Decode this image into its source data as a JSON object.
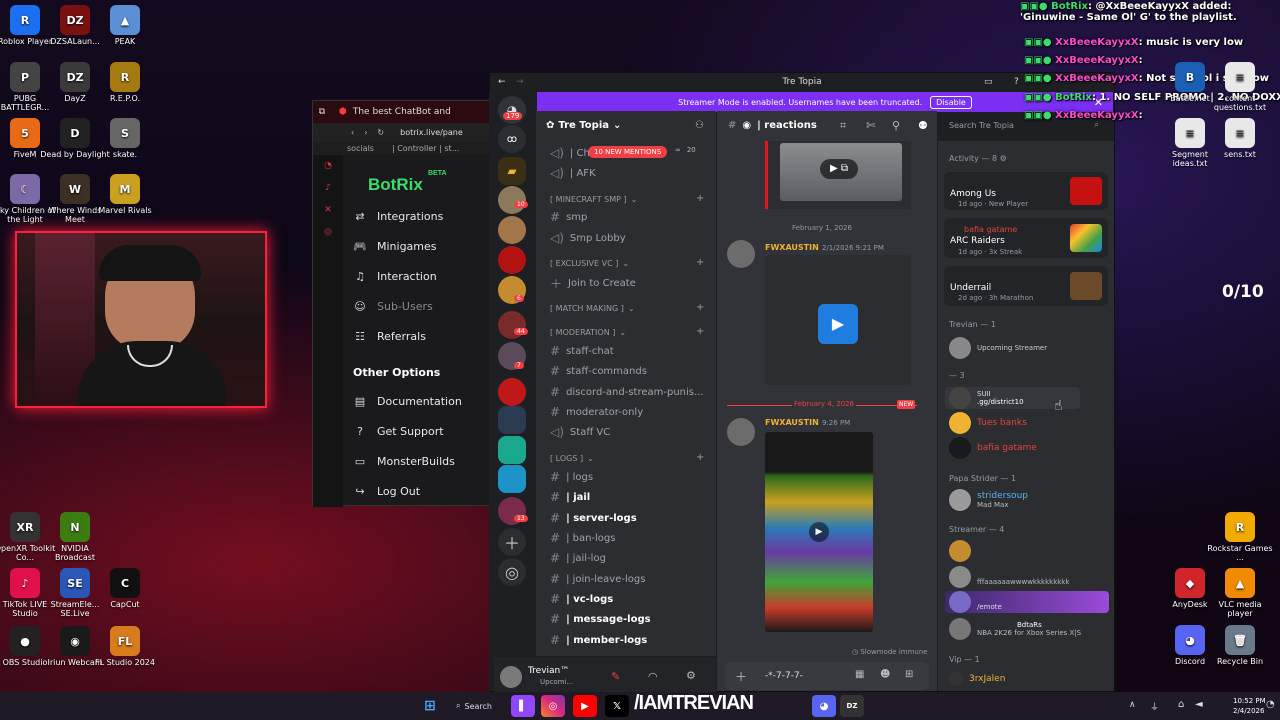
{
  "desktop_icons_left": [
    {
      "label": "Roblox Player",
      "glyph": "R",
      "color": "#1d6ff2"
    },
    {
      "label": "DZSALaun...",
      "glyph": "DZ",
      "color": "#7a1010"
    },
    {
      "label": "PEAK",
      "glyph": "▲",
      "color": "#5a8fd6"
    },
    {
      "label": "PUBG BATTLEGR...",
      "glyph": "P",
      "color": "#444"
    },
    {
      "label": "DayZ",
      "glyph": "DZ",
      "color": "#3a3a3a"
    },
    {
      "label": "R.E.P.O.",
      "glyph": "R",
      "color": "#a57a12"
    },
    {
      "label": "FiveM",
      "glyph": "5",
      "color": "#e86a17"
    },
    {
      "label": "Dead by Daylight",
      "glyph": "D",
      "color": "#222"
    },
    {
      "label": "skate.",
      "glyph": "S",
      "color": "#666"
    },
    {
      "label": "Sky Children of the Light",
      "glyph": "☾",
      "color": "#7c6aa6"
    },
    {
      "label": "Where Winds Meet",
      "glyph": "W",
      "color": "#3c2f24"
    },
    {
      "label": "Marvel Rivals",
      "glyph": "M",
      "color": "#c9a020"
    },
    {
      "label": "OpenXR Toolkit Co...",
      "glyph": "XR",
      "color": "#333"
    },
    {
      "label": "NVIDIA Broadcast",
      "glyph": "N",
      "color": "#3c7d12"
    },
    {
      "label": "TikTok LIVE Studio",
      "glyph": "♪",
      "color": "#e0114a"
    },
    {
      "label": "StreamEle... SE.Live",
      "glyph": "SE",
      "color": "#2a56b8"
    },
    {
      "label": "CapCut",
      "glyph": "C",
      "color": "#111"
    },
    {
      "label": "OBS Studio",
      "glyph": "●",
      "color": "#222"
    },
    {
      "label": "Iriun Webcam",
      "glyph": "◉",
      "color": "#1a1a1a"
    },
    {
      "label": "FL Studio 2024",
      "glyph": "FL",
      "color": "#d77b1c"
    }
  ],
  "desktop_icons_right": [
    {
      "label": "Battle.net",
      "glyph": "B",
      "color": "#1a5fb4"
    },
    {
      "label": "content questions.txt",
      "glyph": "≡",
      "color": "#e8e8e8"
    },
    {
      "label": "Segment ideas.txt",
      "glyph": "≡",
      "color": "#e8e8e8"
    },
    {
      "label": "sens.txt",
      "glyph": "≡",
      "color": "#e8e8e8"
    },
    {
      "label": "Rockstar Games ...",
      "glyph": "R",
      "color": "#f2a900"
    },
    {
      "label": "AnyDesk",
      "glyph": "◆",
      "color": "#d1252c"
    },
    {
      "label": "VLC media player",
      "glyph": "▲",
      "color": "#f28a00"
    },
    {
      "label": "Discord",
      "glyph": "◕",
      "color": "#5865f2"
    },
    {
      "label": "Recycle Bin",
      "glyph": "🗑",
      "color": "#6a7a8a"
    }
  ],
  "overlay": {
    "counter": "0/10",
    "chat": [
      {
        "user": "BotRix",
        "text": ": @XxBeeeKayyxX added: 'Ginuwine - Same Ol' G' to the playlist."
      },
      {
        "user": "XxBeeeKayyxX",
        "text": ": music is very low"
      },
      {
        "user": "XxBeeeKayyxX",
        "text": ":"
      },
      {
        "user": "XxBeeeKayyxX",
        "text": ": Not slow lol i said low"
      },
      {
        "user": "BotRix",
        "text": ": 1. NO SELF PROMO | 2. NO DOXXING"
      },
      {
        "user": "XxBeeeKayyxX",
        "text": ":"
      }
    ]
  },
  "botrix": {
    "tab_title": "The best ChatBot and",
    "url": "botrix.live/pane",
    "bookmarks": [
      "socials",
      "| Controller | st..."
    ],
    "logo": "BotRix",
    "beta": "BETA",
    "menu": [
      {
        "label": "Integrations",
        "icon": "⇄",
        "icon_name": "integrations-icon"
      },
      {
        "label": "Minigames",
        "icon": "🎮",
        "icon_name": "gamepad-icon"
      },
      {
        "label": "Interaction",
        "icon": "♫",
        "icon_name": "music-icon"
      },
      {
        "label": "Sub-Users",
        "icon": "☺",
        "icon_name": "users-icon"
      },
      {
        "label": "Referrals",
        "icon": "☷",
        "icon_name": "referrals-icon"
      }
    ],
    "other_heading": "Other Options",
    "other": [
      {
        "label": "Documentation",
        "icon": "▤",
        "icon_name": "document-icon"
      },
      {
        "label": "Get Support",
        "icon": "?",
        "icon_name": "support-icon"
      },
      {
        "label": "MonsterBuilds",
        "icon": "▭",
        "icon_name": "monitor-icon"
      },
      {
        "label": "Log Out",
        "icon": "↪",
        "icon_name": "logout-icon"
      }
    ]
  },
  "discord": {
    "title": "Tre Topia",
    "streamer_banner": "Streamer Mode is enabled. Usernames have been truncated.",
    "disable_label": "Disable",
    "server_name": "Tre Topia",
    "channel_header": "| reactions",
    "search_placeholder": "Search Tre Topia",
    "new_mentions": "10 NEW MENTIONS",
    "mentions_count": "20",
    "home_badge": "179",
    "channels_top": [
      {
        "label": "| Ch",
        "type": "voice"
      },
      {
        "label": "| AFK",
        "type": "voice"
      }
    ],
    "cat_minecraft": "[ MINECRAFT SMP ]",
    "minecraft": [
      {
        "label": "smp",
        "type": "text"
      },
      {
        "label": "Smp Lobby",
        "type": "voice"
      }
    ],
    "cat_exclusive": "[ EXCLUSIVE VC ]",
    "exclusive": [
      {
        "label": "Join to Create",
        "type": "plus"
      }
    ],
    "cat_matchmaking": "[ MATCH MAKING ]",
    "cat_moderation": "[ MODERATION ]",
    "moderation": [
      {
        "label": "staff-chat",
        "type": "text"
      },
      {
        "label": "staff-commands",
        "type": "text"
      },
      {
        "label": "discord-and-stream-punis...",
        "type": "text"
      },
      {
        "label": "moderator-only",
        "type": "text"
      },
      {
        "label": "Staff VC",
        "type": "voice"
      }
    ],
    "cat_logs": "[ LOGS ]",
    "logs": [
      {
        "label": "| logs",
        "bold": false
      },
      {
        "label": "| jail",
        "bold": true
      },
      {
        "label": "| server-logs",
        "bold": true
      },
      {
        "label": "| ban-logs",
        "bold": false
      },
      {
        "label": "| jail-log",
        "bold": false
      },
      {
        "label": "| join-leave-logs",
        "bold": false
      },
      {
        "label": "| vc-logs",
        "bold": true
      },
      {
        "label": "| message-logs",
        "bold": true
      },
      {
        "label": "| member-logs",
        "bold": true
      }
    ],
    "user_panel": {
      "name": "Trevian™",
      "status": "Upcomi..."
    },
    "date_divider_1": "February 1, 2026",
    "msg1": {
      "author": "FWXAUSTIN",
      "time": "2/1/2026 9:21 PM"
    },
    "date_divider_2": "February 4, 2026",
    "new_label": "NEW",
    "msg2": {
      "author": "FWXAUSTIN",
      "time": "9:26 PM"
    },
    "composer": "-*-7-7-7-",
    "slowmode": "Slowmode immune",
    "server_badges": [
      "10",
      "6",
      "44",
      "7",
      "13"
    ],
    "members": {
      "activity_header": "Activity — 8",
      "activities": [
        {
          "game": "Among Us",
          "meta": "1d ago",
          "extra": "New Player"
        },
        {
          "game": "ARC Raiders",
          "meta": "1d ago",
          "extra": "3x Streak",
          "user": "bafia gatame"
        },
        {
          "game": "Underrail",
          "meta": "2d ago",
          "extra": "3h Marathon"
        }
      ],
      "group1": "Trevian — 1",
      "g1_status": "Upcoming Streamer",
      "group2": "— 3",
      "g2_members": [
        {
          "name": "SUII",
          "status": ".gg/district10",
          "color": "#cfcfcf"
        },
        {
          "name": "Tues banks",
          "status": "",
          "color": "#e2443b"
        },
        {
          "name": "bafia gatame",
          "status": "",
          "color": "#e2443b"
        }
      ],
      "group3": "Papa Strider — 1",
      "g3_member": {
        "name": "stridersoup",
        "status": "Mad Max"
      },
      "group4": "Streamer — 4",
      "g4_members": [
        {
          "status": "fffaaaaaawwwwkkkkkkkkk"
        },
        {
          "status": "/emote"
        },
        {
          "status": "NBA 2K26 for Xbox Series X|S",
          "tag": "BdtaRs"
        }
      ],
      "group5": "Vip — 1",
      "g5_member": "3rxJalen"
    }
  },
  "taskbar": {
    "search": "Search",
    "time": "10:52 PM",
    "date": "2/4/2026",
    "watermark": "/IAMTREVIAN"
  }
}
